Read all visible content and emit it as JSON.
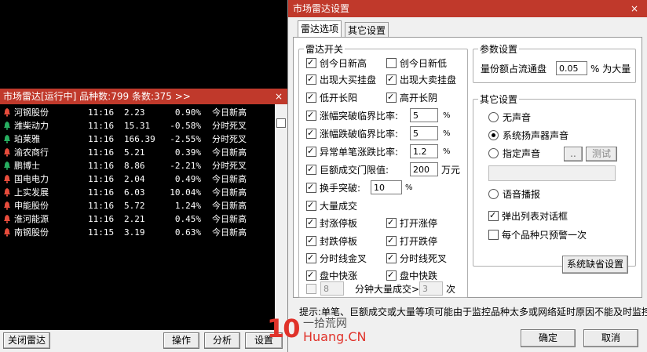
{
  "radar": {
    "title": "市场雷达[运行中] 品种数:799 条数:375  >>",
    "close": "×",
    "rows": [
      {
        "name": "河钢股份",
        "time": "11:16",
        "price": "2.23",
        "pct": "0.90%",
        "signal": "今日新高"
      },
      {
        "name": "潍柴动力",
        "time": "11:16",
        "price": "15.31",
        "pct": "-0.58%",
        "signal": "分时死叉"
      },
      {
        "name": "珀莱雅",
        "time": "11:16",
        "price": "166.39",
        "pct": "-2.55%",
        "signal": "分时死叉"
      },
      {
        "name": "渝农商行",
        "time": "11:16",
        "price": "5.21",
        "pct": "0.39%",
        "signal": "今日新高"
      },
      {
        "name": "鹏博士",
        "time": "11:16",
        "price": "8.86",
        "pct": "-2.21%",
        "signal": "分时死叉"
      },
      {
        "name": "国电电力",
        "time": "11:16",
        "price": "2.04",
        "pct": "0.49%",
        "signal": "今日新高"
      },
      {
        "name": "上实发展",
        "time": "11:16",
        "price": "6.03",
        "pct": "10.04%",
        "signal": "今日新高"
      },
      {
        "name": "申能股份",
        "time": "11:16",
        "price": "5.72",
        "pct": "1.24%",
        "signal": "今日新高"
      },
      {
        "name": "淮河能源",
        "time": "11:16",
        "price": "2.21",
        "pct": "0.45%",
        "signal": "今日新高"
      },
      {
        "name": "南钢股份",
        "time": "11:15",
        "price": "3.19",
        "pct": "0.63%",
        "signal": "今日新高"
      }
    ],
    "buttons": {
      "close_radar": "关闭雷达",
      "operate": "操作",
      "analyze": "分析",
      "settings": "设置"
    }
  },
  "dialog": {
    "title": "市场雷达设置",
    "close": "×",
    "tabs": [
      "雷达选项",
      "其它设置"
    ],
    "switch_group": {
      "legend": "雷达开关",
      "new_high": "创今日新高",
      "new_low": "创今日新低",
      "big_buy": "出现大买挂盘",
      "big_sell": "出现大卖挂盘",
      "low_open_up": "低开长阳",
      "high_open_down": "高开长阴",
      "rise_break": "涨幅突破临界比率:",
      "rise_break_val": "5",
      "fall_break": "涨幅跌破临界比率:",
      "fall_break_val": "5",
      "abnormal": "异常单笔涨跌比率:",
      "abnormal_val": "1.2",
      "huge_trade": "巨额成交门限值:",
      "huge_trade_val": "200",
      "huge_trade_unit": "万元",
      "turnover": "换手突破:",
      "turnover_val": "10",
      "percent": "%",
      "big_volume": "大量成交",
      "limit_up_seal": "封涨停板",
      "open_limit_up": "打开涨停",
      "limit_down_seal": "封跌停板",
      "open_limit_down": "打开跌停",
      "golden_cross": "分时线金叉",
      "death_cross": "分时线死叉",
      "fast_rise": "盘中快涨",
      "fast_fall": "盘中快跌",
      "minute_val": "8",
      "minute_label": "分钟大量成交>",
      "times_val": "3",
      "times_label": "次"
    },
    "param_group": {
      "legend": "参数设置",
      "label": "量份额占流通盘",
      "value": "0.05",
      "suffix": "% 为大量"
    },
    "other_group": {
      "legend": "其它设置",
      "no_sound": "无声音",
      "system_sound": "系统扬声器声音",
      "custom_sound": "指定声音",
      "browse": "..",
      "test": "测试",
      "voice": "语音播报",
      "popup": "弹出列表对话框",
      "once": "每个品种只预警一次"
    },
    "default_button": "系统缺省设置",
    "tip": "提示:单笔、巨额成交或大量等项可能由于监控品种太多或网络延时原因不能及时监控",
    "ok": "确定",
    "cancel": "取消"
  },
  "watermark": {
    "brand": "10",
    "cn": "一拾荒网",
    "url": "Huang.CN"
  }
}
